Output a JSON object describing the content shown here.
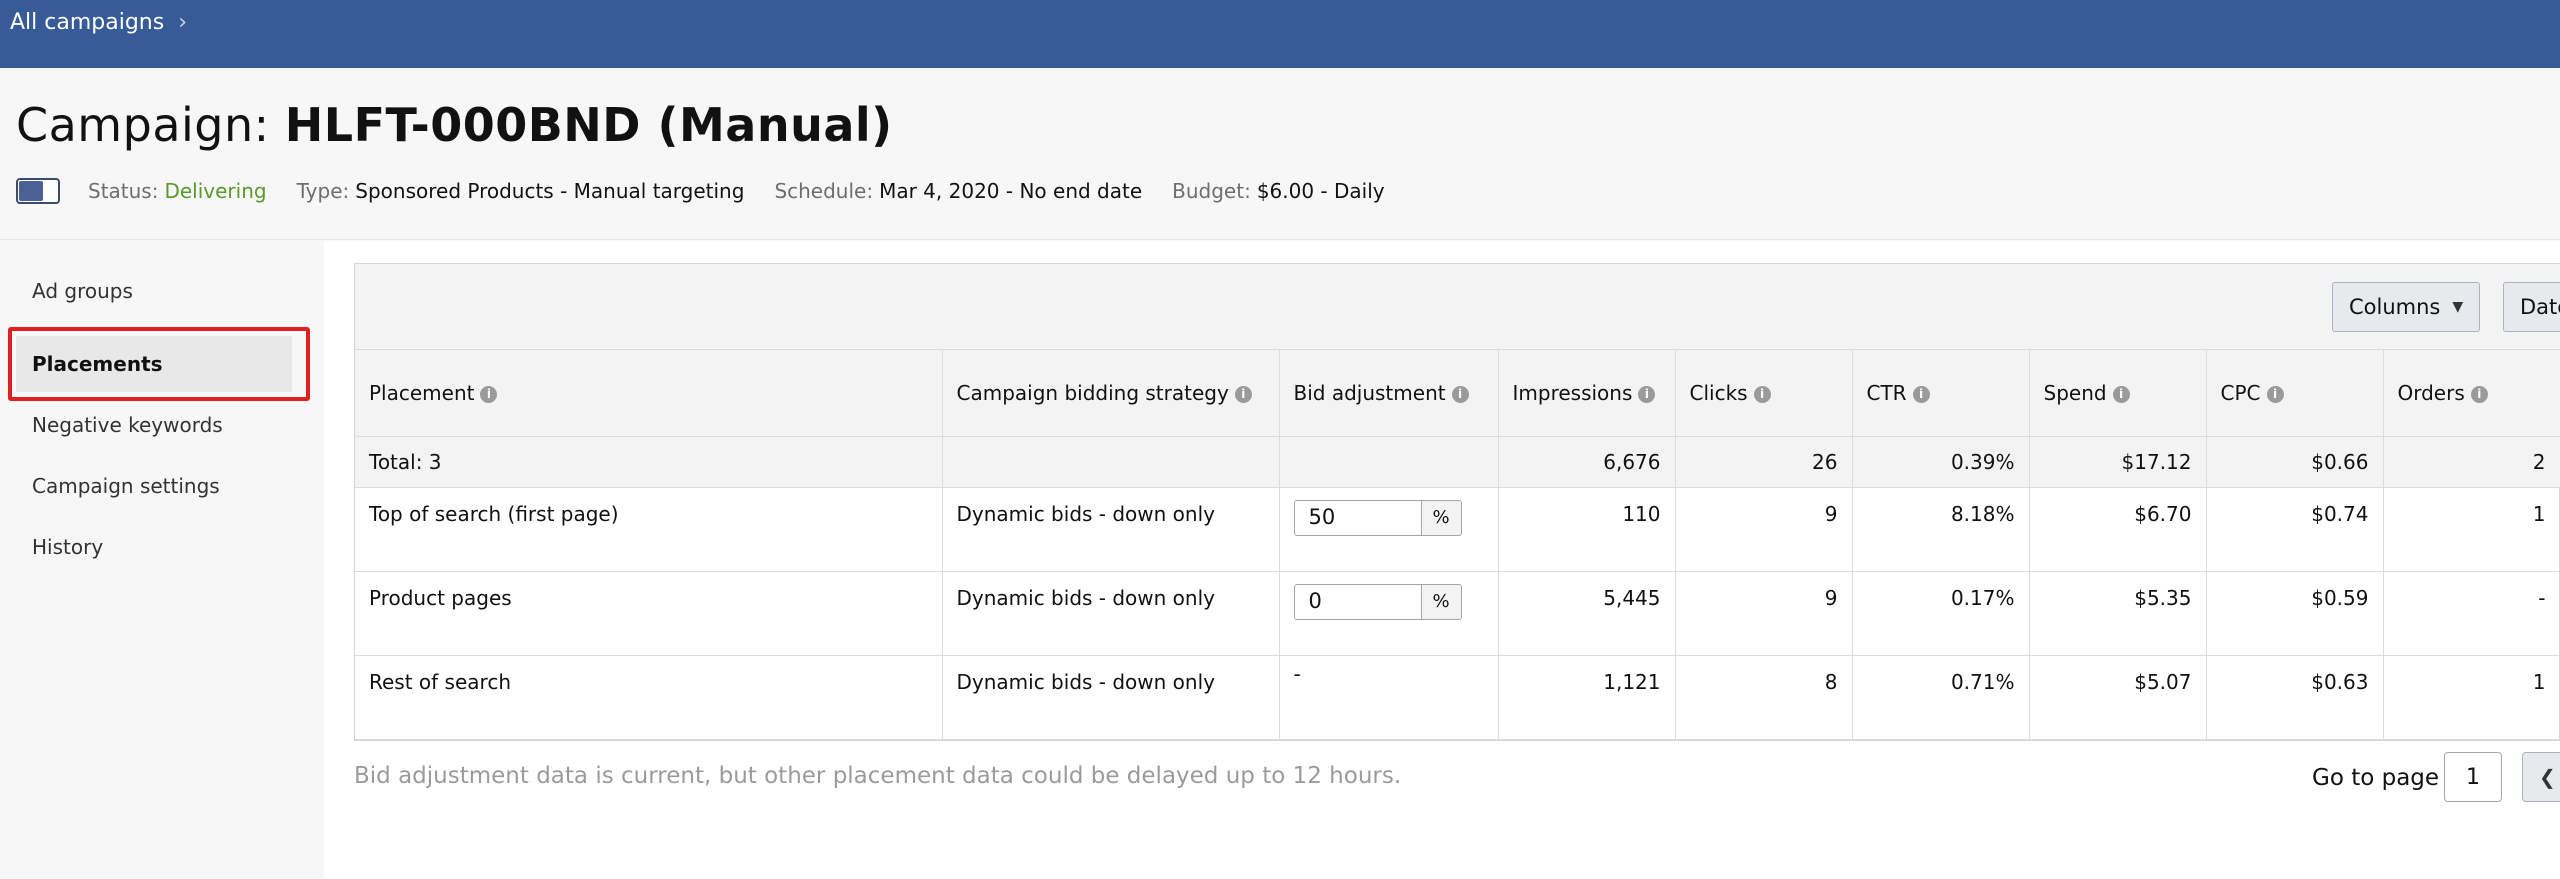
{
  "breadcrumb": {
    "label": "All campaigns"
  },
  "campaign": {
    "title_prefix": "Campaign: ",
    "title_name": "HLFT-000BND (Manual)",
    "status_label": "Status:",
    "status_value": "Delivering",
    "type_label": "Type:",
    "type_value": "Sponsored Products - Manual targeting",
    "schedule_label": "Schedule:",
    "schedule_value": "Mar 4, 2020 - No end date",
    "budget_label": "Budget:",
    "budget_value": "$6.00 - Daily",
    "enabled": true
  },
  "sidebar": {
    "items": [
      {
        "label": "Ad groups"
      },
      {
        "label": "Placements",
        "active": true
      },
      {
        "label": "Negative keywords"
      },
      {
        "label": "Campaign settings"
      },
      {
        "label": "History"
      }
    ]
  },
  "toolbar": {
    "columns_label": "Columns",
    "date_label": "Date"
  },
  "table": {
    "headers": [
      "Placement",
      "Campaign bidding strategy",
      "Bid adjustment",
      "Impressions",
      "Clicks",
      "CTR",
      "Spend",
      "CPC",
      "Orders"
    ],
    "total": {
      "label": "Total: 3",
      "impressions": "6,676",
      "clicks": "26",
      "ctr": "0.39%",
      "spend": "$17.12",
      "cpc": "$0.66",
      "orders": "2"
    },
    "rows": [
      {
        "placement": "Top of search (first page)",
        "strategy": "Dynamic bids - down only",
        "bid": "50",
        "bid_unit": "%",
        "impressions": "110",
        "clicks": "9",
        "ctr": "8.18%",
        "spend": "$6.70",
        "cpc": "$0.74",
        "orders": "1"
      },
      {
        "placement": "Product pages",
        "strategy": "Dynamic bids - down only",
        "bid": "0",
        "bid_unit": "%",
        "impressions": "5,445",
        "clicks": "9",
        "ctr": "0.17%",
        "spend": "$5.35",
        "cpc": "$0.59",
        "orders": "-"
      },
      {
        "placement": "Rest of search",
        "strategy": "Dynamic bids - down only",
        "bid": "-",
        "impressions": "1,121",
        "clicks": "8",
        "ctr": "0.71%",
        "spend": "$5.07",
        "cpc": "$0.63",
        "orders": "1"
      }
    ]
  },
  "footer": {
    "note": "Bid adjustment data is current, but other placement data could be delayed up to 12 hours.",
    "goto_label": "Go to page",
    "page_value": "1"
  },
  "colors": {
    "topbar": "#375b97",
    "status_green": "#5a9a2c",
    "highlight": "#e02020"
  }
}
